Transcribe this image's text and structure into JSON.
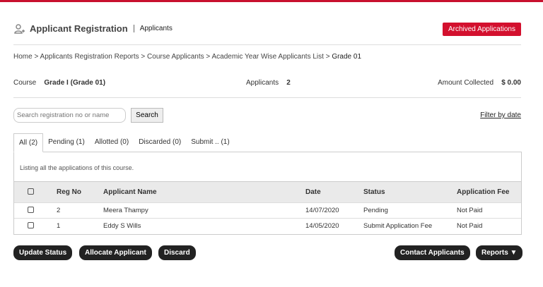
{
  "header": {
    "title": "Applicant Registration",
    "subtitle": "Applicants",
    "archived_label": "Archived Applications"
  },
  "breadcrumb": [
    "Home",
    "Applicants Registration Reports",
    "Course Applicants",
    "Academic Year Wise Applicants List",
    "Grade 01"
  ],
  "summary": {
    "course_label": "Course",
    "course_value": "Grade I (Grade 01)",
    "applicants_label": "Applicants",
    "applicants_value": "2",
    "amount_label": "Amount Collected",
    "amount_value": "$ 0.00"
  },
  "search": {
    "placeholder": "Search registration no or name",
    "button": "Search",
    "filter_link": "Filter by date"
  },
  "tabs": [
    "All (2)",
    "Pending (1)",
    "Allotted (0)",
    "Discarded (0)",
    "Submit .. (1)"
  ],
  "listing_text": "Listing all the applications of this course.",
  "table": {
    "headers": [
      "Reg No",
      "Applicant Name",
      "Date",
      "Status",
      "Application Fee"
    ],
    "rows": [
      [
        "2",
        "Meera Thampy",
        "14/07/2020",
        "Pending",
        "Not Paid"
      ],
      [
        "1",
        "Eddy S Wills",
        "14/05/2020",
        "Submit Application Fee",
        "Not Paid"
      ]
    ]
  },
  "actions": {
    "update": "Update Status",
    "allocate": "Allocate Applicant",
    "discard": "Discard",
    "contact": "Contact Applicants",
    "reports": "Reports ▼"
  },
  "colors": {
    "accent": "#d3102e"
  }
}
